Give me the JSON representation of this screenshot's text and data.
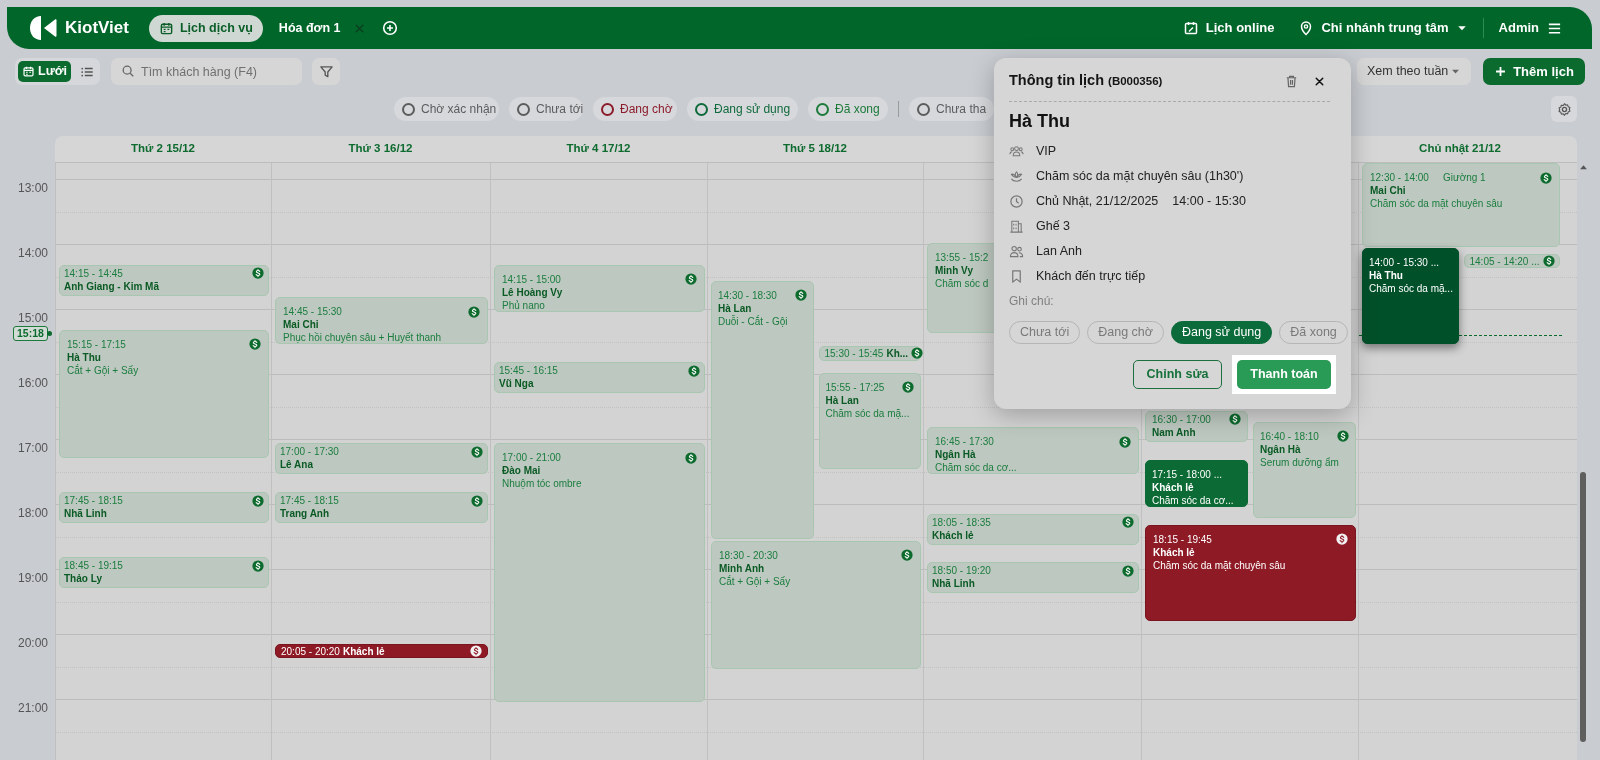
{
  "header": {
    "logo": "KiotViet",
    "tabs": [
      {
        "label": "Lịch dịch vụ",
        "selected": true,
        "closable": false
      },
      {
        "label": "Hóa đơn 1",
        "selected": false,
        "closable": true
      }
    ],
    "online_link": "Lịch online",
    "branch": "Chi nhánh trung tâm",
    "user": "Admin"
  },
  "toolbar": {
    "views": [
      {
        "kind": "grid",
        "label": "Lưới",
        "selected": true
      },
      {
        "kind": "list",
        "selected": false
      }
    ],
    "search": {
      "placeholder": "Tìm khách hàng (F4)"
    },
    "view_mode": "Xem theo tuần",
    "add_button": "Thêm lịch"
  },
  "status_filters": [
    {
      "label": "Chờ xác nhận",
      "color": "#5c5c5c",
      "divider_before": false
    },
    {
      "label": "Chưa tới",
      "color": "#5c5c5c",
      "divider_before": false
    },
    {
      "label": "Đang chờ",
      "color": "#8c1c2c",
      "divider_before": false
    },
    {
      "label": "Đang sử dụng",
      "color": "#0f6a3c",
      "divider_before": false
    },
    {
      "label": "Đã xong",
      "color": "#1c7a3a",
      "divider_before": false
    },
    {
      "label": "Chưa tha",
      "color": "#5c5c5c",
      "divider_before": true
    }
  ],
  "calendar": {
    "time_labels": [
      "13:00",
      "14:00",
      "15:00",
      "16:00",
      "17:00",
      "18:00",
      "19:00",
      "20:00",
      "21:00"
    ],
    "now": {
      "label": "15:18"
    },
    "days": [
      {
        "label": "Thứ 2 15/12",
        "today": false,
        "events": [
          {
            "kind": "booked",
            "selected": false,
            "time": "14:15 - 14:45",
            "name": "Anh Giang - Kim Mã",
            "payment_icon": true
          },
          {
            "kind": "booked",
            "selected": false,
            "time": "15:15 - 17:15",
            "name": "Hà Thu",
            "service": "Cắt + Gội + Sấy",
            "payment_icon": true
          },
          {
            "kind": "booked",
            "selected": false,
            "time": "17:45 - 18:15",
            "name": "Nhã Linh",
            "payment_icon": true
          },
          {
            "kind": "booked",
            "selected": false,
            "time": "18:45 - 19:15",
            "name": "Thảo Ly",
            "payment_icon": true
          }
        ]
      },
      {
        "label": "Thứ 3 16/12",
        "today": false,
        "events": [
          {
            "kind": "booked",
            "selected": false,
            "time": "14:45 - 15:30",
            "name": "Mai Chi",
            "service": "Phục hồi chuyên sâu + Huyết thanh",
            "payment_icon": true
          },
          {
            "kind": "booked",
            "selected": false,
            "time": "17:00 - 17:30",
            "name": "Lê Ana",
            "payment_icon": true
          },
          {
            "kind": "booked",
            "selected": false,
            "time": "17:45 - 18:15",
            "name": "Trang Anh",
            "payment_icon": true
          },
          {
            "kind": "waiting",
            "selected": false,
            "time": "20:05 - 20:20",
            "name": "Khách lẻ",
            "payment_icon": true
          }
        ]
      },
      {
        "label": "Thứ 4 17/12",
        "today": false,
        "events": [
          {
            "kind": "booked",
            "selected": false,
            "time": "14:15 - 15:00",
            "name": "Lê Hoàng Vy",
            "service": "Phủ nano",
            "payment_icon": true
          },
          {
            "kind": "booked",
            "selected": false,
            "time": "15:45 - 16:15",
            "name": "Vũ Nga",
            "payment_icon": true
          },
          {
            "kind": "booked",
            "selected": false,
            "time": "17:00 - 21:00",
            "name": "Đào Mai",
            "service": "Nhuộm tóc ombre",
            "payment_icon": true
          }
        ]
      },
      {
        "label": "Thứ 5 18/12",
        "today": false,
        "events": [
          {
            "kind": "booked",
            "selected": false,
            "time": "14:30 - 18:30",
            "name": "Hà Lan",
            "service": "Duỗi - Cắt - Gội",
            "payment_icon": true
          },
          {
            "kind": "booked",
            "selected": false,
            "time": "15:30 - 15:45",
            "name": "Kh...",
            "payment_icon": true
          },
          {
            "kind": "booked",
            "selected": false,
            "time": "15:55 - 17:25",
            "name": "Hà Lan",
            "service": "Chăm sóc da mặ...",
            "payment_icon": true
          },
          {
            "kind": "booked",
            "selected": false,
            "time": "18:30 - 20:30",
            "name": "Minh Anh",
            "service": "Cắt + Gội + Sấy",
            "payment_icon": true
          }
        ]
      },
      {
        "today": false,
        "events": [
          {
            "kind": "booked",
            "selected": false,
            "time": "13:55 - 15:2",
            "name": "Minh Vy",
            "service": "Chăm sóc d",
            "payment_icon": false
          },
          {
            "kind": "booked",
            "selected": false,
            "time": "16:45 - 17:30",
            "name": "Ngân Hà",
            "service": "Chăm sóc da cơ...",
            "payment_icon": true
          },
          {
            "kind": "booked",
            "selected": false,
            "time": "18:05 - 18:35",
            "name": "Khách lẻ",
            "payment_icon": true
          },
          {
            "kind": "booked",
            "selected": false,
            "time": "18:50 - 19:20",
            "name": "Nhã Linh",
            "payment_icon": true
          }
        ]
      },
      {
        "today": false,
        "events": [
          {
            "kind": "booked",
            "selected": false,
            "time": "16:30 - 17:00",
            "name": "Nam Anh",
            "payment_icon": true
          },
          {
            "kind": "booked",
            "selected": false,
            "time": "16:40 - 18:10",
            "name": "Ngân Hà",
            "service": "Serum dưỡng ẩm",
            "payment_icon": true
          },
          {
            "kind": "in_use",
            "selected": false,
            "time": "17:15 - 18:00 ...",
            "name": "Khách lẻ",
            "service": "Chăm sóc da cơ...",
            "payment_icon": false
          },
          {
            "kind": "waiting",
            "selected": false,
            "time": "18:15 - 19:45",
            "name": "Khách lẻ",
            "service": "Chăm sóc da mặt chuyên sâu",
            "payment_icon": true
          }
        ]
      },
      {
        "label": "Chủ nhật 21/12",
        "today": true,
        "events": [
          {
            "kind": "booked",
            "selected": false,
            "time": "12:30 - 14:00",
            "bed": "Giường 1",
            "name": "Mai Chi",
            "service": "Chăm sóc da mặt chuyên sâu",
            "payment_icon": true
          },
          {
            "kind": "in_use",
            "selected": true,
            "time": "14:00 - 15:30 ...",
            "name": "Hà Thu",
            "service": "Chăm sóc da mặ...",
            "payment_icon": false
          },
          {
            "kind": "booked",
            "selected": false,
            "time": "14:05 - 14:20 ...",
            "payment_icon": true
          }
        ]
      }
    ]
  },
  "popup": {
    "title": "Thông tin lịch",
    "code": "(B000356)",
    "customer": "Hà Thu",
    "details": [
      {
        "kind": "group",
        "text": "VIP"
      },
      {
        "kind": "service",
        "text": "Chăm sóc da mặt chuyên sâu (1h30')"
      },
      {
        "kind": "time",
        "text": "Chủ Nhật, 21/12/2025",
        "extra": "14:00 - 15:30"
      },
      {
        "kind": "seat",
        "text": "Ghế 3"
      },
      {
        "kind": "staff",
        "text": "Lan Anh"
      },
      {
        "kind": "source",
        "text": "Khách đến trực tiếp"
      }
    ],
    "note_label": "Ghi chú:",
    "statuses": [
      {
        "label": "Chưa tới",
        "selected": false
      },
      {
        "label": "Đang chờ",
        "selected": false
      },
      {
        "label": "Đang sử dụng",
        "selected": true
      },
      {
        "label": "Đã xong",
        "selected": false
      }
    ],
    "buttons": [
      {
        "kind": "secondary",
        "label": "Chỉnh sửa",
        "highlighted": false
      },
      {
        "kind": "primary",
        "label": "Thanh toán",
        "highlighted": true
      }
    ]
  }
}
